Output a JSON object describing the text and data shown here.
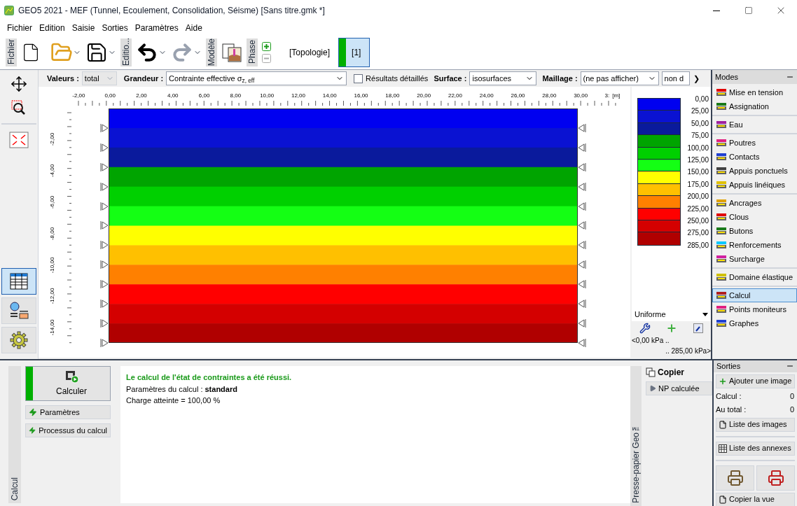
{
  "window": {
    "title": "GEO5 2021 - MEF (Tunnel, Ecoulement, Consolidation, Séisme) [Sans titre.gmk *]"
  },
  "menu": [
    "Fichier",
    "Edition",
    "Saisie",
    "Sorties",
    "Paramètres",
    "Aide"
  ],
  "toolbar": {
    "groups": [
      "Fichier",
      "Editio...",
      "Modèle",
      "Phase"
    ],
    "phases": [
      {
        "label": "[Topologie]",
        "selected": false
      },
      {
        "label": "[1]",
        "selected": true
      }
    ]
  },
  "filters": {
    "values_label": "Valeurs :",
    "values": "total",
    "quantity_label": "Grandeur :",
    "quantity": "Contrainte effective σ$_{z, eff}$",
    "detailed": {
      "label": "Résultats détaillés",
      "checked": false
    },
    "surface_label": "Surface :",
    "surface": "isosurfaces",
    "mesh_label": "Maillage :",
    "mesh": "(ne pas afficher)",
    "extra": "non d",
    "scroll": "❯"
  },
  "ruler": {
    "x_ticks": [
      "-2,00",
      "0,00",
      "2,00",
      "4,00",
      "6,00",
      "8,00",
      "10,00",
      "12,00",
      "14,00",
      "16,00",
      "18,00",
      "20,00",
      "22,00",
      "24,00",
      "26,00",
      "28,00",
      "30,00",
      "3:"
    ],
    "x_unit": "[m]",
    "y_ticks": [
      "-2,00",
      "-4,00",
      "-6,00",
      "-8,00",
      "-10,00",
      "-12,00",
      "-14,00"
    ]
  },
  "left_tools": [
    {
      "kind": "table",
      "selected": true
    },
    {
      "kind": "legend",
      "selected": false
    },
    {
      "kind": "settings",
      "selected": false
    }
  ],
  "legend": {
    "bands": [
      {
        "color": "#0000f0"
      },
      {
        "color": "#0a12d2"
      },
      {
        "color": "#0a1a9c"
      },
      {
        "color": "#00a400"
      },
      {
        "color": "#00d000"
      },
      {
        "color": "#14ff14"
      },
      {
        "color": "#ffff00"
      },
      {
        "color": "#ffc000"
      },
      {
        "color": "#ff8000"
      },
      {
        "color": "#ff0000"
      },
      {
        "color": "#d40000"
      },
      {
        "color": "#b00000"
      }
    ],
    "labels": [
      "0,00",
      "25,00",
      "50,00",
      "75,00",
      "100,00",
      "125,00",
      "150,00",
      "175,00",
      "200,00",
      "225,00",
      "250,00",
      "275,00",
      "285,00"
    ],
    "mode": "Uniforme",
    "range_min": "<0,00 kPa ..",
    "range_max": ".. 285,00 kPa>"
  },
  "modes": {
    "title": "Modes",
    "groups": [
      {
        "items": [
          {
            "label": "Mise en tension",
            "selected": false
          },
          {
            "label": "Assignation",
            "selected": false
          }
        ]
      },
      {
        "items": [
          {
            "label": "Eau",
            "selected": false
          }
        ]
      },
      {
        "items": [
          {
            "label": "Poutres",
            "selected": false
          },
          {
            "label": "Contacts",
            "selected": false
          },
          {
            "label": "Appuis ponctuels",
            "selected": false
          },
          {
            "label": "Appuis linéiques",
            "selected": false
          }
        ]
      },
      {
        "items": [
          {
            "label": "Ancrages",
            "selected": false
          },
          {
            "label": "Clous",
            "selected": false
          },
          {
            "label": "Butons",
            "selected": false
          },
          {
            "label": "Renforcements",
            "selected": false
          },
          {
            "label": "Surcharge",
            "selected": false
          }
        ]
      },
      {
        "items": [
          {
            "label": "Domaine élastique",
            "selected": false
          }
        ]
      },
      {
        "items": [
          {
            "label": "Calcul",
            "selected": true
          },
          {
            "label": "Points moniteurs",
            "selected": false
          },
          {
            "label": "Graphes",
            "selected": false
          }
        ]
      }
    ]
  },
  "calc": {
    "side_label": "Calcul",
    "run": "Calculer",
    "buttons": [
      "Paramètres",
      "Processus du calcul"
    ],
    "messages": [
      {
        "kind": "success",
        "text": "Le calcul de l'état de contraintes a été réussi."
      },
      {
        "kind": "plain",
        "text": "Paramètres du calcul : **standard**"
      },
      {
        "kind": "plain",
        "text": "Charge atteinte = 100,00 %"
      }
    ]
  },
  "clipboard": {
    "side_label": "Presse-papier Geo™",
    "copy": "Copier",
    "items": [
      "NP calculée"
    ]
  },
  "outputs": {
    "title": "Sorties",
    "add": "Ajouter une image",
    "stats": [
      {
        "label": "Calcul :",
        "value": "0"
      },
      {
        "label": "Au total :",
        "value": "0"
      }
    ],
    "list_images": "Liste des images",
    "list_annexes": "Liste des annexes",
    "copy_view": "Copier la vue"
  }
}
